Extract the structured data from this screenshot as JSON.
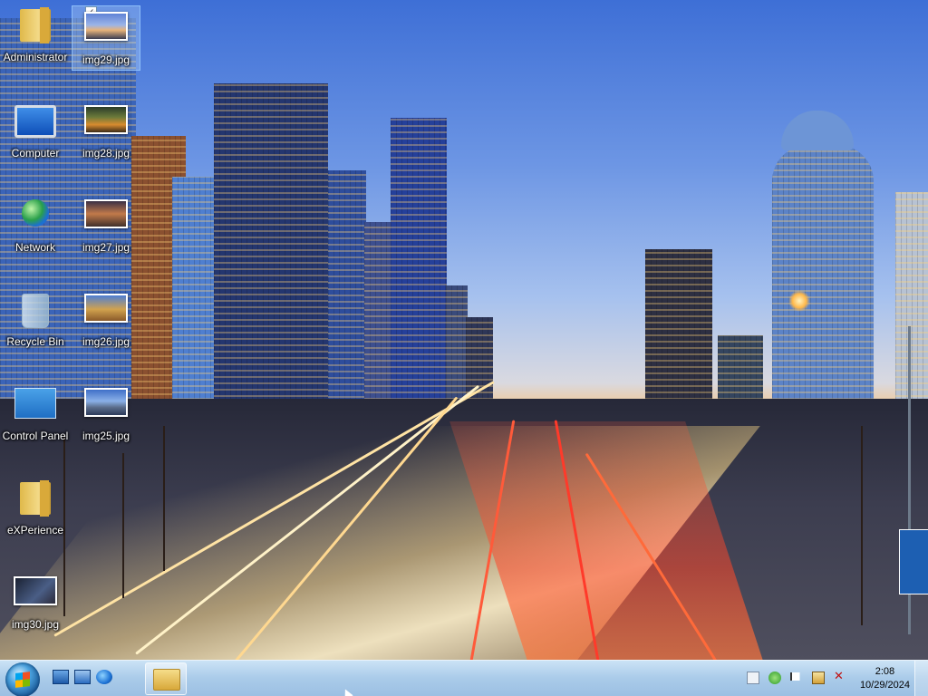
{
  "desktop": {
    "icons": [
      {
        "label": "Administrator"
      },
      {
        "label": "img29.jpg"
      },
      {
        "label": "Computer"
      },
      {
        "label": "img28.jpg"
      },
      {
        "label": "Network"
      },
      {
        "label": "img27.jpg"
      },
      {
        "label": "Recycle Bin"
      },
      {
        "label": "img26.jpg"
      },
      {
        "label": "Control Panel"
      },
      {
        "label": "img25.jpg"
      },
      {
        "label": "eXPerience"
      },
      {
        "label": "img30.jpg"
      }
    ]
  },
  "taskbar": {
    "clock": {
      "time": "2:08",
      "date": "10/29/2024"
    }
  }
}
